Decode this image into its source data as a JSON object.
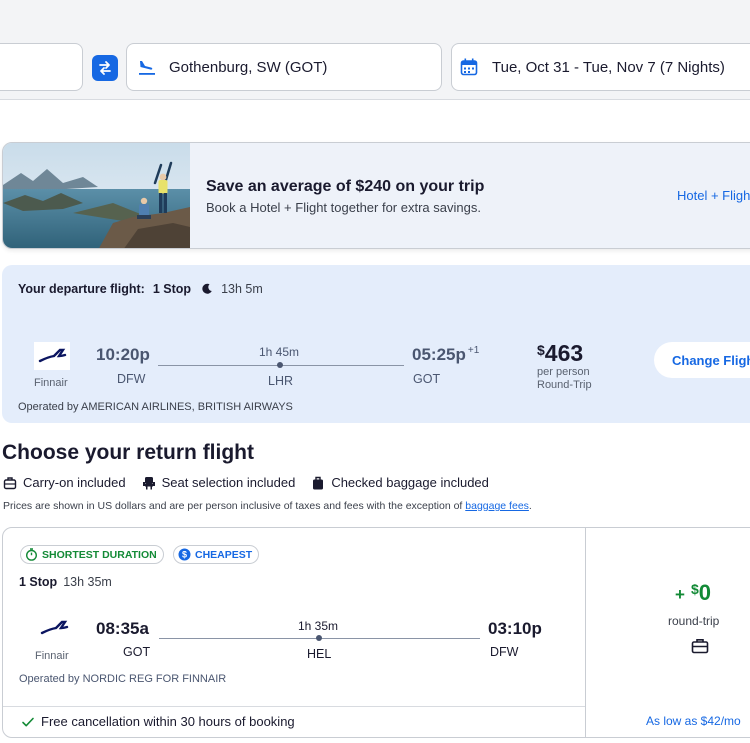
{
  "search": {
    "destination": "Gothenburg, SW (GOT)",
    "dates": "Tue, Oct 31 - Tue, Nov 7 (7 Nights)"
  },
  "promo": {
    "title": "Save an average of $240 on your trip",
    "subtitle": "Book a Hotel + Flight together for extra savings.",
    "link": "Hotel + Flight"
  },
  "departure": {
    "label": "Your departure flight:",
    "stops": "1 Stop",
    "duration": "13h 5m",
    "airline": "Finnair",
    "depart_time": "10:20p",
    "depart_code": "DFW",
    "leg_duration": "1h 45m",
    "via_code": "LHR",
    "arrive_time": "05:25p",
    "arrive_offset": "+1",
    "arrive_code": "GOT",
    "price_currency": "$",
    "price": "463",
    "per_person": "per person",
    "trip_type": "Round-Trip",
    "change_label": "Change Flight",
    "operated_by": "Operated by AMERICAN AIRLINES, BRITISH AIRWAYS"
  },
  "return_section": {
    "title": "Choose your return flight",
    "amenities": [
      "Carry-on included",
      "Seat selection included",
      "Checked baggage included"
    ],
    "disclaimer": "Prices are shown in US dollars and are per person inclusive of taxes and fees with the exception of",
    "disclaimer_link": "baggage fees",
    "disclaimer_end": "."
  },
  "return_flight": {
    "badges": [
      "SHORTEST DURATION",
      "CHEAPEST"
    ],
    "stops": "1 Stop",
    "duration": "13h 35m",
    "airline": "Finnair",
    "depart_time": "08:35a",
    "depart_code": "GOT",
    "leg_duration": "1h 35m",
    "via_code": "HEL",
    "arrive_time": "03:10p",
    "arrive_code": "DFW",
    "operated_by": "Operated by NORDIC REG FOR FINNAIR",
    "free_cancel": "Free cancellation within 30 hours of booking",
    "price_sign": "+",
    "price_currency": "$",
    "price": "0",
    "price_note": "round-trip",
    "as_low_as": "As low as $42/mo"
  },
  "colors": {
    "accent": "#1668e3",
    "success": "#138a36",
    "departure_bg": "#e4edfb"
  }
}
